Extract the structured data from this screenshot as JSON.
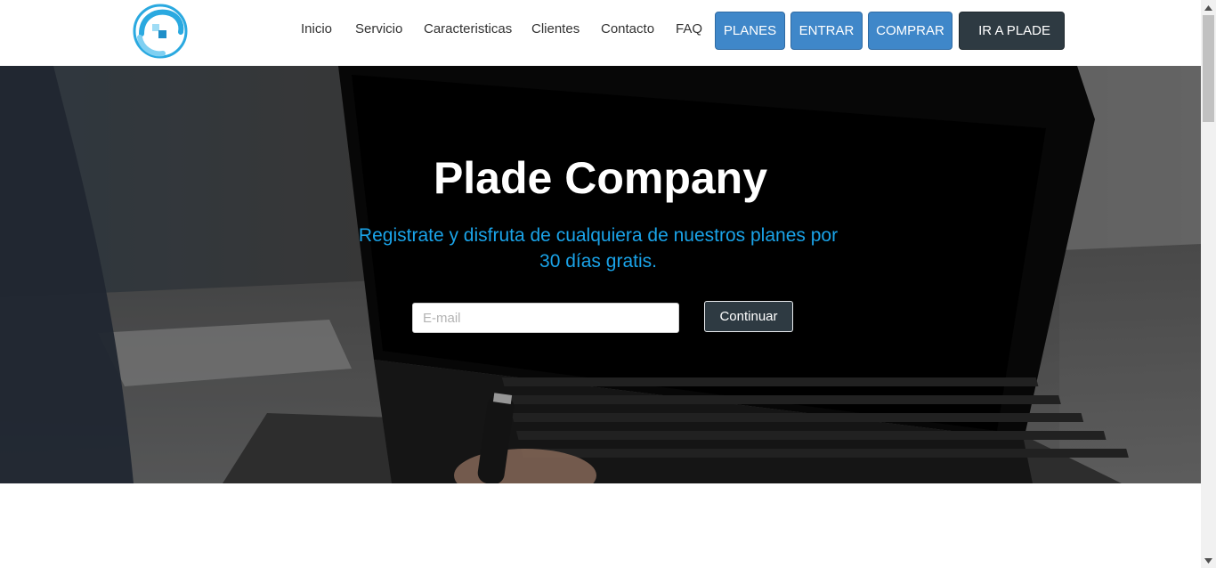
{
  "header": {
    "nav_links": [
      "Inicio",
      "Servicio",
      "Caracteristicas",
      "Clientes",
      "Contacto",
      "FAQ"
    ],
    "buttons": {
      "planes": "PLANES",
      "entrar": "ENTRAR",
      "comprar": "COMPRAR",
      "ir_a_plade": "IR A PLADE"
    },
    "logo_icon": "plade-logo-icon"
  },
  "hero": {
    "title": "Plade Company",
    "subtitle": "Registrate y disfruta de cualquiera de nuestros planes por 30 días gratis.",
    "email_placeholder": "E-mail",
    "email_value": "",
    "continue_label": "Continuar"
  },
  "colors": {
    "accent_blue": "#3f87c9",
    "dark_button": "#2e3a42",
    "subtitle_blue": "#1aa3e8"
  }
}
